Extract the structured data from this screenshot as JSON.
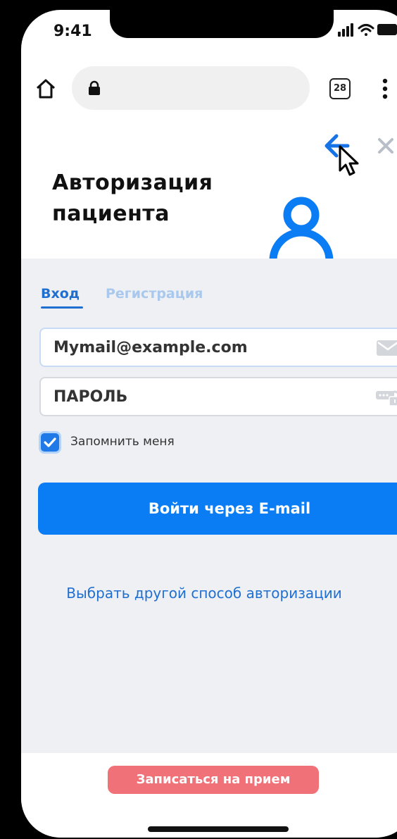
{
  "status_bar": {
    "time": "9:41",
    "icons": [
      "signal-icon",
      "wifi-icon",
      "battery-icon"
    ]
  },
  "browser": {
    "tab_count": "28",
    "icons": [
      "home-icon",
      "lock-icon",
      "more-vert-icon"
    ]
  },
  "modal": {
    "title_line1": "Авторизация",
    "title_line2": "пациента",
    "icons": [
      "back-arrow-icon",
      "close-icon",
      "cursor-icon",
      "user-avatar-icon"
    ]
  },
  "tabs": {
    "login": "Вход",
    "register": "Регистрация",
    "active": "login"
  },
  "form": {
    "email_value": "Mymail@example.com",
    "password_placeholder": "ПАРОЛЬ",
    "remember_label": "Запомнить меня",
    "remember_checked": true,
    "submit_label": "Войти через E-mail",
    "alt_link": "Выбрать другой способ авторизации"
  },
  "footer": {
    "cta_label": "Записаться на прием"
  },
  "colors": {
    "primary": "#0a7cf4",
    "link": "#1f6fd1",
    "tab_inactive": "#a9c8ee",
    "cta": "#f07178",
    "body_bg": "#eef0f4"
  }
}
